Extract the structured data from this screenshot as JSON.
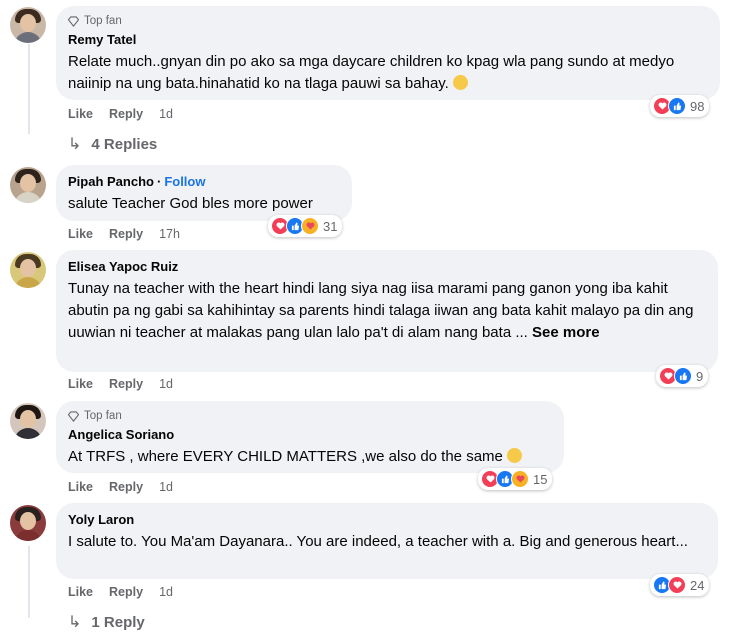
{
  "comments": [
    {
      "top_fan": "Top fan",
      "name": "Remy Tatel",
      "follow": "",
      "text": "Relate much..gnyan din po ako sa mga daycare children ko kpag wla pang sundo at medyo naiinip na ung bata.hinahatid ko na tlaga pauwi sa bahay.",
      "see_more": "",
      "like": "Like",
      "reply": "Reply",
      "time": "1d",
      "reaction_count": "98",
      "reactions": [
        "love-icon",
        "like-icon"
      ],
      "replies": "4 Replies"
    },
    {
      "top_fan": "",
      "name": "Pipah Pancho",
      "follow": "Follow",
      "text": "salute Teacher God bles more power",
      "see_more": "",
      "like": "Like",
      "reply": "Reply",
      "time": "17h",
      "reaction_count": "31",
      "reactions": [
        "love-icon",
        "like-icon",
        "care-icon"
      ],
      "replies": ""
    },
    {
      "top_fan": "",
      "name": "Elisea Yapoc Ruiz",
      "follow": "",
      "text": "Tunay na teacher with the heart hindi lang siya nag iisa marami pang ganon yong iba kahit abutin pa ng gabi sa kahihintay sa parents hindi talaga iiwan ang bata kahit malayo pa din ang uuwian ni teacher at malakas pang ulan lalo pa't di alam nang bata ...",
      "see_more": "See more",
      "like": "Like",
      "reply": "Reply",
      "time": "1d",
      "reaction_count": "9",
      "reactions": [
        "love-icon",
        "like-icon"
      ],
      "replies": ""
    },
    {
      "top_fan": "Top fan",
      "name": "Angelica Soriano",
      "follow": "",
      "text": "At TRFS , where EVERY CHILD MATTERS ,we also do the same",
      "see_more": "",
      "like": "Like",
      "reply": "Reply",
      "time": "1d",
      "reaction_count": "15",
      "reactions": [
        "love-icon",
        "like-icon",
        "care-icon"
      ],
      "replies": ""
    },
    {
      "top_fan": "",
      "name": "Yoly Laron",
      "follow": "",
      "text": "I salute to. You Ma'am Dayanara.. You are indeed, a teacher with a. Big and generous heart...",
      "see_more": "",
      "like": "Like",
      "reply": "Reply",
      "time": "1d",
      "reaction_count": "24",
      "reactions": [
        "like-icon",
        "love-icon"
      ],
      "replies": "1 Reply"
    }
  ],
  "colors": {
    "bubble": "#f0f2f5",
    "secondary_text": "#65676b",
    "link": "#1b74e4",
    "love": "#f33e58",
    "like": "#1877f2",
    "care": "#f7b125"
  }
}
